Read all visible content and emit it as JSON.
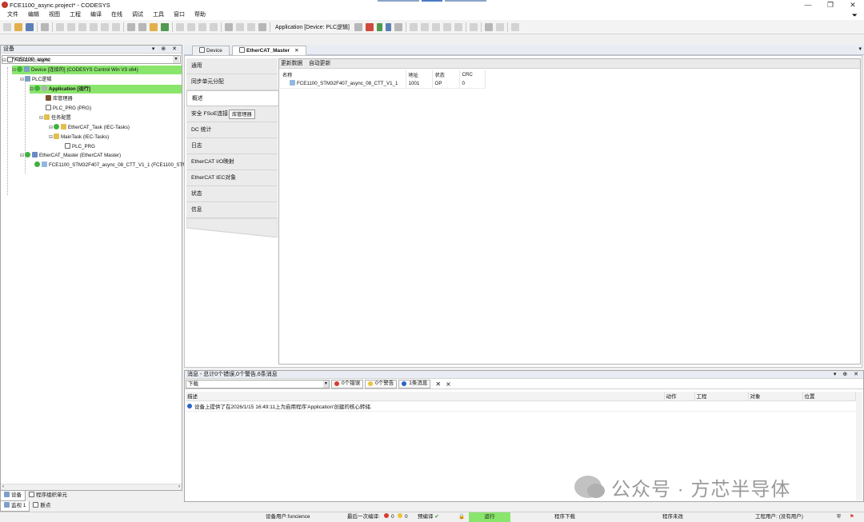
{
  "window": {
    "title": "FCE1100_async.project* - CODESYS",
    "controls": [
      "—",
      "❐",
      "✕"
    ]
  },
  "menu": [
    "文件",
    "编辑",
    "视图",
    "工程",
    "编译",
    "在线",
    "调试",
    "工具",
    "窗口",
    "帮助"
  ],
  "toolbar": {
    "active_app": "Application [Device: PLC逻辑]"
  },
  "devices_panel": {
    "title": "设备",
    "controls": "▾ ⊕ ✕",
    "project_combo": "FCE1100_async",
    "tree": [
      {
        "label": "FCE1100_async",
        "italic": true
      },
      {
        "label": "Device [连接的] (CODESYS Control Win V3 x64)"
      },
      {
        "label": "PLC逻辑"
      },
      {
        "label": "Application [运行]"
      },
      {
        "label": "库管理器"
      },
      {
        "label": "PLC_PRG (PRG)"
      },
      {
        "label": "任务配置"
      },
      {
        "label": "EtherCAT_Task (IEC-Tasks)"
      },
      {
        "label": "MainTask (IEC-Tasks)"
      },
      {
        "label": "PLC_PRG"
      },
      {
        "label": "EtherCAT_Master (EtherCAT Master)"
      },
      {
        "label": "FCE1100_STM32F407_async_08_CTT_V1_1 (FCE1100_STM"
      }
    ],
    "bottom_tabs": [
      "设备",
      "程序组织单元"
    ],
    "bottom_tabs2": [
      "监视 1",
      "断点"
    ]
  },
  "editor": {
    "tabs": [
      {
        "label": "Device"
      },
      {
        "label": "EtherCAT_Master",
        "close": "✕"
      }
    ],
    "config_tabs": [
      "通用",
      "同步单元分配",
      "概述",
      "安全 FSoE连接",
      "DC 统计",
      "日志",
      "EtherCAT I/O映射",
      "EtherCAT IEC对象",
      "状态",
      "信息"
    ],
    "fsoe_button": "库管理器",
    "overview": {
      "toolbar": [
        "更新数据",
        "自动更新"
      ],
      "columns": [
        "名称",
        "地址",
        "状态",
        "CRC"
      ],
      "rows": [
        {
          "name": "FCE1100_STM32F407_async_08_CTT_V1_1",
          "address": "1001",
          "state": "OP",
          "crc": "0"
        }
      ]
    }
  },
  "messages": {
    "title": "消息 - 总计0个错误,0个警告,6条消息",
    "controls": "▾ ⊕ ✕",
    "filter": "下载",
    "errors": "0个错误",
    "warnings": "0个警告",
    "infos": "1条消息",
    "columns": [
      "描述",
      "动作",
      "工程",
      "对象",
      "位置"
    ],
    "rows": [
      {
        "desc": "设备上提供了在2026/1/15 16:49:11上为启用程序'Application'创建的核心转储."
      }
    ]
  },
  "watermark": "公众号 · 方芯半导体",
  "status_bar": {
    "device_user": "设备用户:funcience",
    "last_compile_label": "最后一次编译:",
    "last_compile_errors": "0",
    "last_compile_warnings": "0",
    "precompile": "预编译",
    "run_state": "运行",
    "program_download": "程序下载",
    "program_changed": "程序未改",
    "project_user": "工程用户: (没有用户)"
  }
}
